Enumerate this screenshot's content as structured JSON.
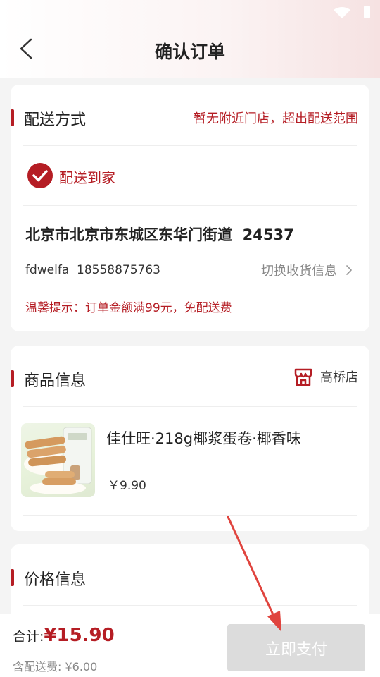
{
  "header": {
    "title": "确认订单"
  },
  "delivery": {
    "section_title": "配送方式",
    "notice": "暂无附近门店，超出配送范围",
    "option_label": "配送到家",
    "address": "北京市北京市东城区东华门街道  24537",
    "contact_name": "fdwelfa",
    "contact_phone": "18558875763",
    "switch_label": "切换收货信息",
    "tip": "温馨提示：订单金额满99元，免配送费"
  },
  "goods": {
    "section_title": "商品信息",
    "store_name": "高桥店",
    "item_name": "佳仕旺·218g椰浆蛋卷·椰香味",
    "item_price": "￥9.90"
  },
  "price": {
    "section_title": "价格信息"
  },
  "footer": {
    "total_label": "合计:",
    "total_value": "¥15.90",
    "fee_label": "含配送费: ¥6.00",
    "pay_label": "立即支付"
  },
  "colors": {
    "accent": "#b51d24",
    "disabled_button": "#dcdcdc",
    "annotation_arrow": "#e0443e"
  }
}
